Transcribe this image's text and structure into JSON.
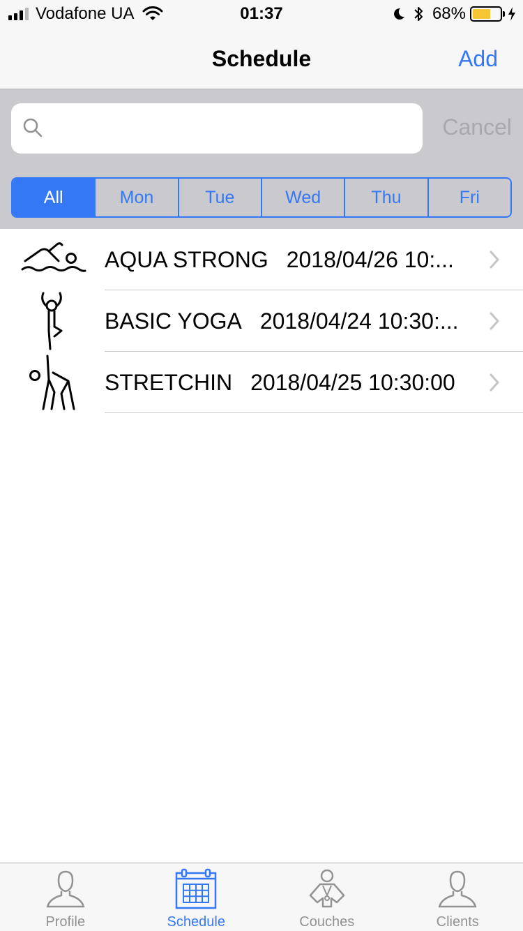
{
  "status_bar": {
    "carrier": "Vodafone UA",
    "time": "01:37",
    "battery_percent": "68%",
    "battery_level": 0.68,
    "signal_bars": 3
  },
  "nav": {
    "title": "Schedule",
    "add_label": "Add"
  },
  "search": {
    "placeholder": "",
    "value": "",
    "cancel_label": "Cancel"
  },
  "segments": [
    {
      "label": "All",
      "selected": true
    },
    {
      "label": "Mon",
      "selected": false
    },
    {
      "label": "Tue",
      "selected": false
    },
    {
      "label": "Wed",
      "selected": false
    },
    {
      "label": "Thu",
      "selected": false
    },
    {
      "label": "Fri",
      "selected": false
    }
  ],
  "classes": [
    {
      "name": "AQUA STRONG",
      "date": "2018/04/26 10:...",
      "icon": "swimmer-icon"
    },
    {
      "name": "BASIC YOGA",
      "date": "2018/04/24 10:30:...",
      "icon": "yoga-pose-icon"
    },
    {
      "name": "STRETCHIN",
      "date": "2018/04/25 10:30:00",
      "icon": "stretching-icon"
    }
  ],
  "tabs": [
    {
      "label": "Profile",
      "icon": "person-icon",
      "active": false
    },
    {
      "label": "Schedule",
      "icon": "calendar-icon",
      "active": true
    },
    {
      "label": "Couches",
      "icon": "coach-icon",
      "active": false
    },
    {
      "label": "Clients",
      "icon": "person-icon",
      "active": false
    }
  ],
  "colors": {
    "accent": "#3478f6",
    "battery_fill": "#f5c534",
    "search_bg": "#c9c9ce",
    "inactive_tab": "#929292"
  }
}
